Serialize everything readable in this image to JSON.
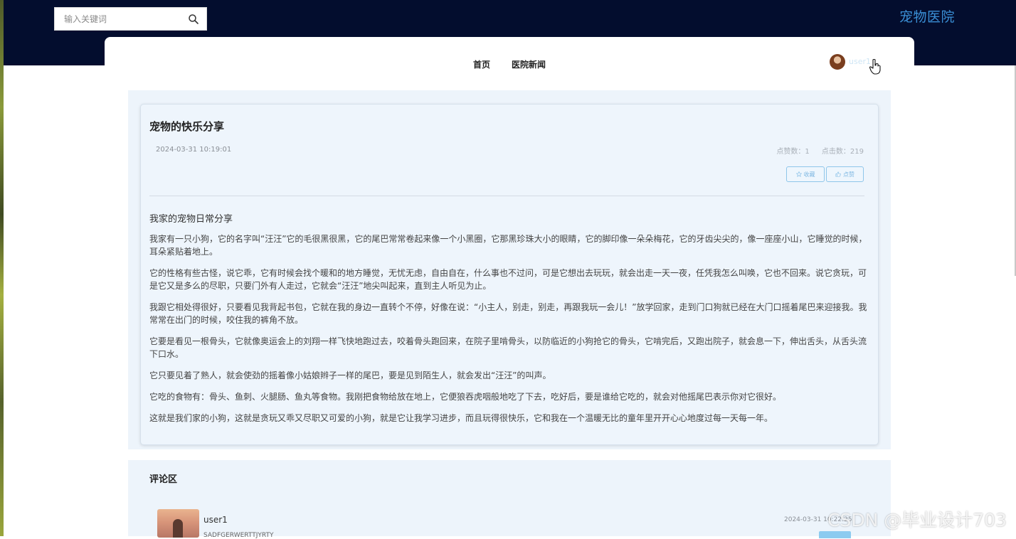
{
  "header": {
    "search_placeholder": "输入关键词",
    "site_title": "宠物医院"
  },
  "nav": {
    "items": [
      {
        "label": "首页"
      },
      {
        "label": "医院新闻"
      }
    ],
    "user_name": "user1"
  },
  "article": {
    "title": "宠物的快乐分享",
    "date": "2024-03-31 10:19:01",
    "likes_label": "点赞数：1",
    "clicks_label": "点击数：219",
    "favorite_label": "收藏",
    "like_label": "点赞",
    "subtitle": "我家的宠物日常分享",
    "paragraphs": [
      "我家有一只小狗，它的名字叫“汪汪”它的毛很黑很黑，它的尾巴常常卷起来像一个小黑圈，它那黑珍珠大小的眼睛，它的脚印像一朵朵梅花，它的牙齿尖尖的，像一座座小山，它睡觉的时候，耳朵紧贴着地上。",
      "它的性格有些古怪，说它乖，它有时候会找个暖和的地方睡觉，无忧无虑，自由自在，什么事也不过问，可是它想出去玩玩，就会出走一天一夜，任凭我怎么叫唤，它也不回来。说它贪玩，可是它又是多么的尽职，只要门外有人走过，它就会“汪汪”地尖叫起来，直到主人听见为止。",
      "我跟它相处得很好，只要看见我背起书包，它就在我的身边一直转个不停，好像在说：“小主人，别走，别走，再跟我玩一会儿！”放学回家，走到门口狗就已经在大门口摇着尾巴来迎接我。我常常在出门的时候，咬住我的裤角不放。",
      "它要是看见一根骨头，它就像奥运会上的刘翔一样飞快地跑过去，咬着骨头跑回来，在院子里啃骨头，以防临近的小狗抢它的骨头，它啃完后，又跑出院子，就会息一下，伸出舌头，从舌头流下口水。",
      "它只要见着了熟人，就会使劲的摇着像小姑娘辫子一样的尾巴，要是见到陌生人，就会发出“汪汪”的叫声。",
      "它吃的食物有：骨头、鱼刺、火腿肠、鱼丸等食物。我刚把食物给放在地上，它便狼吞虎咽般地吃了下去，吃好后，要是谁给它吃的，就会对他摇尾巴表示你对它很好。",
      "这就是我们家的小狗，这就是贪玩又乖又尽职又可爱的小狗，就是它让我学习进步，而且玩得很快乐，它和我在一个温暖无比的童年里开开心心地度过每一天每一年。"
    ]
  },
  "comments": {
    "title": "评论区",
    "items": [
      {
        "user": "user1",
        "date": "2024-03-31 10:22:25",
        "text": "SADFGERWERTTJYRTY"
      }
    ]
  },
  "watermark": "CSDN @毕业设计703"
}
